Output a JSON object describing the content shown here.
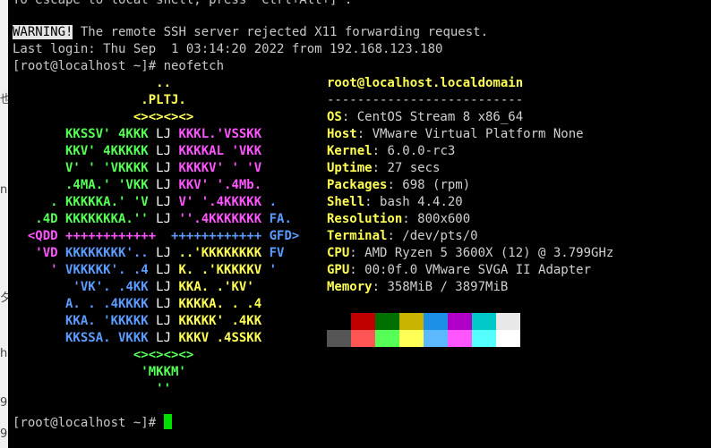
{
  "terminal": {
    "top_partial": "To escape to local shell, press 'Ctrl+Alt+]'.",
    "warning_tag": "WARNING!",
    "warning_text": " The remote SSH server rejected X11 forwarding request.",
    "last_login": "Last login: Thu Sep  1 03:14:20 2022 from 192.168.123.180",
    "prompt1": "[root@localhost ~]# neofetch",
    "prompt2": "[root@localhost ~]# "
  },
  "logo": {
    "lines": [
      [
        [
          "                   ..",
          "y"
        ]
      ],
      [
        [
          "                 .PLTJ.",
          "y"
        ]
      ],
      [
        [
          "                <><><><>",
          "y"
        ]
      ],
      [
        [
          "       KKSSV' 4KKK ",
          "g"
        ],
        [
          "LJ ",
          "w"
        ],
        [
          "KKKL.'VSSKK",
          "m"
        ]
      ],
      [
        [
          "       KKV' 4KKKKK ",
          "g"
        ],
        [
          "LJ ",
          "w"
        ],
        [
          "KKKKAL 'VKK",
          "m"
        ]
      ],
      [
        [
          "       V' ' 'VKKKK ",
          "g"
        ],
        [
          "LJ ",
          "w"
        ],
        [
          "KKKKV' ' 'V",
          "m"
        ]
      ],
      [
        [
          "       .4MA.' 'VKK ",
          "g"
        ],
        [
          "LJ ",
          "w"
        ],
        [
          "KKV' '.4Mb.",
          "m"
        ]
      ],
      [
        [
          "     . KKKKKA.' 'V ",
          "g"
        ],
        [
          "LJ ",
          "w"
        ],
        [
          "V' '.4KKKKK",
          "m"
        ],
        [
          " .",
          "b"
        ]
      ],
      [
        [
          "   .4D KKKKKKKA.'' ",
          "g"
        ],
        [
          "LJ ",
          "w"
        ],
        [
          "''.4KKKKKKK",
          "m"
        ],
        [
          " FA.",
          "b"
        ]
      ],
      [
        [
          "  <QDD ",
          "m"
        ],
        [
          "++++++++++++  ",
          "m"
        ],
        [
          "++++++++++++",
          "b"
        ],
        [
          " GFD>",
          "b"
        ]
      ],
      [
        [
          "   'VD ",
          "m"
        ],
        [
          "KKKKKKKK'.. ",
          "b"
        ],
        [
          "LJ ",
          "w"
        ],
        [
          "..'KKKKKKKK",
          "y"
        ],
        [
          " FV",
          "b"
        ]
      ],
      [
        [
          "     ' ",
          "m"
        ],
        [
          "VKKKKK'. .4 ",
          "b"
        ],
        [
          "LJ ",
          "w"
        ],
        [
          "K. .'KKKKKV",
          "y"
        ],
        [
          " '",
          "b"
        ]
      ],
      [
        [
          "        'VK'. ",
          "b"
        ],
        [
          ".4KK ",
          "b"
        ],
        [
          "LJ ",
          "w"
        ],
        [
          "KKA. .'KV'",
          "y"
        ]
      ],
      [
        [
          "       A. . .4KKKK ",
          "b"
        ],
        [
          "LJ ",
          "w"
        ],
        [
          "KKKKA. . .4",
          "y"
        ]
      ],
      [
        [
          "       KKA. 'KKKKK ",
          "b"
        ],
        [
          "LJ ",
          "w"
        ],
        [
          "KKKKK' .4KK",
          "y"
        ]
      ],
      [
        [
          "       KKSSA. VKKK ",
          "b"
        ],
        [
          "LJ ",
          "w"
        ],
        [
          "KKKV .4SSKK",
          "y"
        ]
      ],
      [
        [
          "                <><><><>",
          "g"
        ]
      ],
      [
        [
          "                 'MKKM'",
          "g"
        ]
      ],
      [
        [
          "                   ''",
          "g"
        ]
      ]
    ]
  },
  "info": {
    "title": "root@localhost.localdomain",
    "separator": "--------------------------",
    "fields": [
      {
        "label": "OS",
        "value": "CentOS Stream 8 x86_64"
      },
      {
        "label": "Host",
        "value": "VMware Virtual Platform None"
      },
      {
        "label": "Kernel",
        "value": "6.0.0-rc3"
      },
      {
        "label": "Uptime",
        "value": "27 secs"
      },
      {
        "label": "Packages",
        "value": "698 (rpm)"
      },
      {
        "label": "Shell",
        "value": "bash 4.4.20"
      },
      {
        "label": "Resolution",
        "value": "800x600"
      },
      {
        "label": "Terminal",
        "value": "/dev/pts/0"
      },
      {
        "label": "CPU",
        "value": "AMD Ryzen 5 3600X (12) @ 3.799GHz"
      },
      {
        "label": "GPU",
        "value": "00:0f.0 VMware SVGA II Adapter"
      },
      {
        "label": "Memory",
        "value": "358MiB / 3897MiB"
      }
    ]
  },
  "palette": {
    "row1": [
      "#000000",
      "#c00000",
      "#007000",
      "#c8b400",
      "#1e8fe6",
      "#b000c8",
      "#00c8c8",
      "#e8e8e8"
    ],
    "row2": [
      "#555555",
      "#ff5555",
      "#55ff55",
      "#ffff55",
      "#5cb8ff",
      "#ff55ff",
      "#55ffff",
      "#ffffff"
    ]
  },
  "side_fragments": [
    "也",
    "na",
    "夕",
    "h",
    "9",
    "9"
  ],
  "colors": {
    "cursor": "#00e000",
    "background": "#000000"
  }
}
